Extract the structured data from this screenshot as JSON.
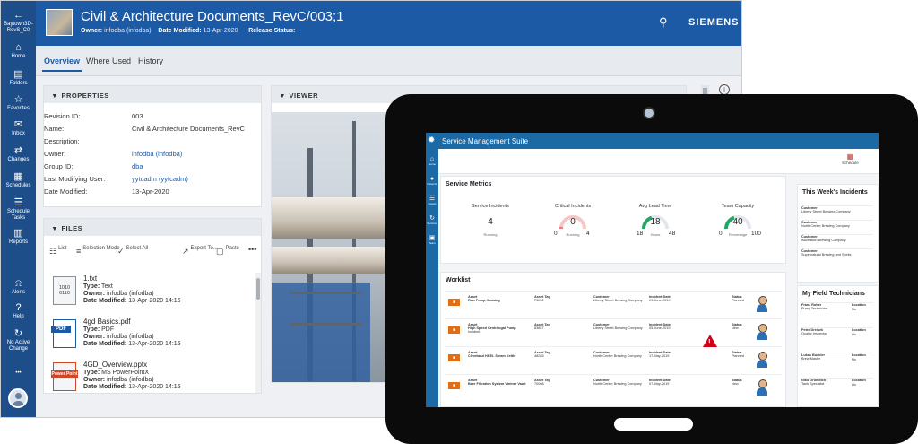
{
  "nav": {
    "items": [
      {
        "icon": "back-arrow-icon",
        "label": "Baytown3D-RevS_C0"
      },
      {
        "icon": "home-icon",
        "label": "Home"
      },
      {
        "icon": "folder-icon",
        "label": "Folders"
      },
      {
        "icon": "star-icon",
        "label": "Favorites"
      },
      {
        "icon": "inbox-icon",
        "label": "Inbox"
      },
      {
        "icon": "changes-icon",
        "label": "Changes"
      },
      {
        "icon": "schedule-icon",
        "label": "Schedules"
      },
      {
        "icon": "schedule-tasks-icon",
        "label": "Schedule Tasks"
      },
      {
        "icon": "reports-icon",
        "label": "Reports"
      },
      {
        "icon": "bell-icon",
        "label": "Alerts"
      },
      {
        "icon": "help-icon",
        "label": "Help"
      },
      {
        "icon": "no-active-change-icon",
        "label": "No Active Change"
      },
      {
        "icon": "more-icon",
        "label": "•••"
      }
    ]
  },
  "header": {
    "title": "Civil & Architecture Documents_RevC/003;1",
    "owner_label": "Owner:",
    "owner_value": "infodba (infodba)",
    "modified_label": "Date Modified:",
    "modified_value": "13-Apr-2020",
    "release_label": "Release Status:",
    "brand": "SIEMENS"
  },
  "tabs": [
    "Overview",
    "Where Used",
    "History"
  ],
  "properties": {
    "heading": "PROPERTIES",
    "rows": [
      {
        "k": "Revision ID:",
        "v": "003",
        "link": false
      },
      {
        "k": "Name:",
        "v": "Civil & Architecture Documents_RevC",
        "link": false
      },
      {
        "k": "Description:",
        "v": "",
        "link": false
      },
      {
        "k": "Owner:",
        "v": "infodba (infodba)",
        "link": true
      },
      {
        "k": "Group ID:",
        "v": "dba",
        "link": true
      },
      {
        "k": "Last Modifying User:",
        "v": "yytcadm (yytcadm)",
        "link": true
      },
      {
        "k": "Date Modified:",
        "v": "13-Apr-2020",
        "link": false
      }
    ]
  },
  "files": {
    "heading": "FILES",
    "toolbar": [
      {
        "icon": "list-icon",
        "label": "List"
      },
      {
        "icon": "selection-mode-icon",
        "label": "Selection Mode"
      },
      {
        "icon": "select-all-icon",
        "label": "Select All"
      },
      {
        "icon": "export-icon",
        "label": "Export To..."
      },
      {
        "icon": "paste-icon",
        "label": "Paste"
      },
      {
        "icon": "more-icon",
        "label": "•••"
      }
    ],
    "items": [
      {
        "name": "1.txt",
        "type": "Text",
        "owner": "infodba (infodba)",
        "modified": "13-Apr-2020 14:16",
        "icon_text": "1010\n0110",
        "kind": "txt"
      },
      {
        "name": "4gd Basics.pdf",
        "type": "PDF",
        "owner": "infodba (infodba)",
        "modified": "13-Apr-2020 14:16",
        "icon_text": "PDF",
        "kind": "pdf"
      },
      {
        "name": "4GD_Overview.pptx",
        "type": "MS PowerPointX",
        "owner": "infodba (infodba)",
        "modified": "13-Apr-2020 14:16",
        "icon_text": "Power Point",
        "kind": "ppt"
      }
    ],
    "labels": {
      "type": "Type:",
      "owner": "Owner:",
      "modified": "Date Modified:"
    }
  },
  "viewer": {
    "heading": "VIEWER"
  },
  "tablet": {
    "app_title": "Service Management Suite",
    "side": [
      {
        "icon": "home-icon",
        "label": "Home"
      },
      {
        "icon": "globe-icon",
        "label": "Network"
      },
      {
        "icon": "assets-icon",
        "label": "Assets"
      },
      {
        "icon": "refresh-icon",
        "label": "Services"
      },
      {
        "icon": "lock-icon",
        "label": "Team"
      }
    ],
    "schedule_label": "Schedule",
    "metrics": {
      "heading": "Service Metrics",
      "items": [
        {
          "label": "Service Incidents",
          "value": "4",
          "sub": "Running",
          "min": "",
          "max": ""
        },
        {
          "label": "Critical Incidents",
          "value": "0",
          "sub": "Running",
          "min": "0",
          "max": "4",
          "level": 0.05,
          "color": "#f27b7b"
        },
        {
          "label": "Avg Lead Time",
          "value": "18",
          "sub": "Hours",
          "min": "18",
          "max": "48",
          "level": 0.4,
          "color": "#27a567"
        },
        {
          "label": "Team Capacity",
          "value": "40",
          "sub": "Percentage",
          "min": "0",
          "max": "100",
          "level": 0.4,
          "color": "#27a567"
        }
      ]
    },
    "worklist": {
      "heading": "Worklist",
      "rows": [
        {
          "asset": "Raw Pump Housing",
          "tag": "75202",
          "customer": "Liberty Street Brewing Company",
          "date": "09-June-2019",
          "status": "Planned"
        },
        {
          "asset": "High Speed Centrifugal Pump",
          "asset_sub": "Incident",
          "tag": "83857",
          "customer": "Liberty Street Brewing Company",
          "date": "05-June-2019",
          "status": "New"
        },
        {
          "asset": "Cleveland HKEL Steam Kettle",
          "tag": "48285",
          "customer": "North Center Brewing Company",
          "date": "17-May-2019",
          "status": "Planned"
        },
        {
          "asset": "Beer Filtration System Vintner Vault",
          "tag": "70008",
          "customer": "North Center Brewing Company",
          "date": "07-May-2019",
          "status": "New"
        }
      ],
      "labels": {
        "asset": "Asset",
        "tag": "Asset Tag",
        "customer": "Customer",
        "date": "Incident Date",
        "status": "Status"
      }
    },
    "incidents": {
      "heading": "This Week's Incidents",
      "items": [
        {
          "label": "Customer",
          "value": "Liberty Street Brewing Company"
        },
        {
          "label": "Customer",
          "value": "North Center Brewing Company"
        },
        {
          "label": "Customer",
          "value": "Ascension Brewing Company"
        },
        {
          "label": "Customer",
          "value": "Supernatural Brewing and Spirits"
        }
      ]
    },
    "techs": {
      "heading": "My Field Technicians",
      "location_label": "Location",
      "items": [
        {
          "name": "Franz Rutter",
          "role": "Pump Technician",
          "loc": "Ho"
        },
        {
          "name": "Peter Dreisek",
          "role": "Quality Inspector",
          "loc": "Ho"
        },
        {
          "name": "Lukas Buckler",
          "role": "Brew Master",
          "loc": "Ho"
        },
        {
          "name": "Niko Grundlich",
          "role": "Tank Specialist",
          "loc": "Ho"
        }
      ]
    }
  }
}
